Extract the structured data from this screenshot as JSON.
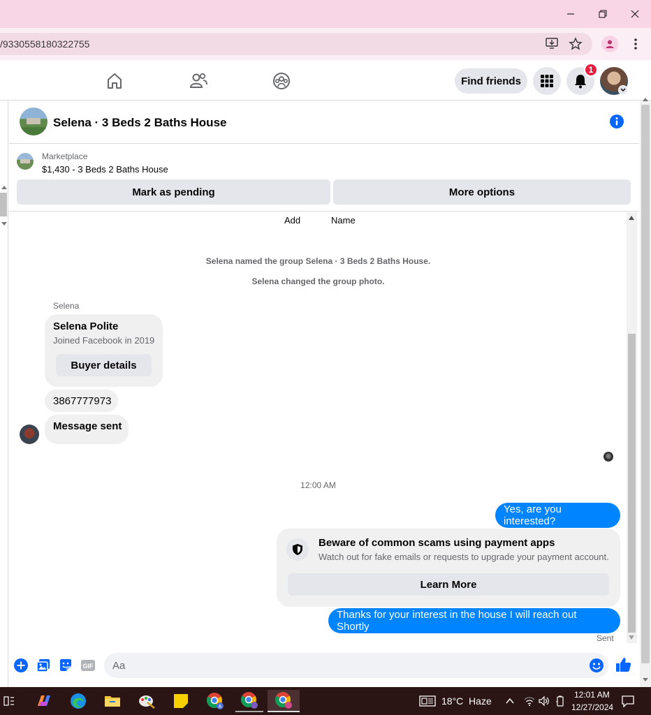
{
  "browser": {
    "url": "/9330558180322755",
    "window_controls": {
      "minimize": "minimize-icon",
      "restore": "restore-icon",
      "close": "close-icon"
    }
  },
  "nav": {
    "find_friends_label": "Find friends",
    "notification_count": "1"
  },
  "chat": {
    "title": "Selena · 3 Beds 2 Baths House",
    "marketplace": {
      "label": "Marketplace",
      "listing": "$1,430 - 3 Beds 2 Baths House",
      "mark_pending_label": "Mark as pending",
      "more_options_label": "More options"
    },
    "top_actions": {
      "add": "Add",
      "name": "Name"
    },
    "system_messages": [
      "Selena named the group Selena · 3 Beds 2 Baths House.",
      "Selena changed the group photo."
    ],
    "sender_name": "Selena",
    "profile_card": {
      "name": "Selena Polite",
      "joined": "Joined Facebook in 2019",
      "button_label": "Buyer details"
    },
    "incoming_messages": [
      "3867777973",
      "Message sent"
    ],
    "timestamp": "12:00 AM",
    "outgoing_messages": [
      "Yes, are you interested?",
      "Thanks for your interest in the house I will reach out Shortly"
    ],
    "warning": {
      "title": "Beware of common scams using payment apps",
      "body": "Watch out for fake emails or requests to upgrade your payment account.",
      "button_label": "Learn More"
    },
    "status": "Sent",
    "composer_placeholder": "Aa"
  },
  "taskbar": {
    "weather": "18°C  Haze",
    "time": "12:01 AM",
    "date": "12/27/2024"
  },
  "colors": {
    "messenger_blue": "#0084ff",
    "notification_red": "#e41e3f",
    "titlebar_pink": "#f8d6e6",
    "taskbar": "#2a1414"
  }
}
